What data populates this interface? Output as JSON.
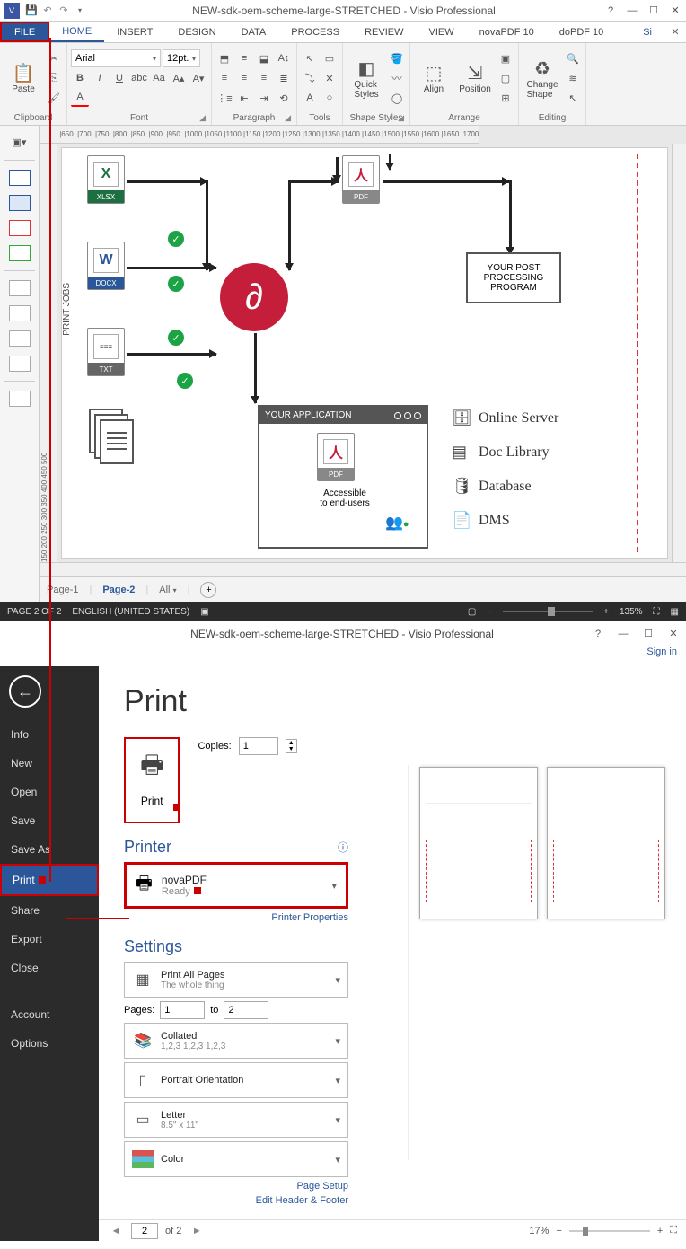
{
  "titlebar": {
    "app_icon_text": "V",
    "title": "NEW-sdk-oem-scheme-large-STRETCHED - Visio Professional",
    "help": "?",
    "signin_partial": "Si"
  },
  "tabs": {
    "file": "FILE",
    "home": "HOME",
    "insert": "INSERT",
    "design": "DESIGN",
    "data": "DATA",
    "process": "PROCESS",
    "review": "REVIEW",
    "view": "VIEW",
    "nova": "novaPDF 10",
    "dopdf": "doPDF 10"
  },
  "ribbon": {
    "clipboard": {
      "paste": "Paste",
      "label": "Clipboard"
    },
    "font": {
      "name": "Arial",
      "size": "12pt.",
      "label": "Font"
    },
    "paragraph": {
      "label": "Paragraph"
    },
    "tools": {
      "label": "Tools"
    },
    "shape_styles": {
      "quick": "Quick\nStyles",
      "label": "Shape Styles"
    },
    "arrange": {
      "align": "Align",
      "position": "Position",
      "label": "Arrange"
    },
    "editing": {
      "change": "Change\nShape",
      "label": "Editing"
    }
  },
  "pages": {
    "p1": "Page-1",
    "p2": "Page-2",
    "all": "All"
  },
  "status": {
    "page": "PAGE 2 OF 2",
    "lang": "ENGLISH (UNITED STATES)",
    "zoom": "135%"
  },
  "drawing": {
    "vlabel": "PRINT JOBS",
    "xlsx": "XLSX",
    "docx": "DOCX",
    "txt": "TXT",
    "pdf": "PDF",
    "your_app": "YOUR APPLICATION",
    "accessible": "Accessible\nto end-users",
    "proc": "YOUR POST PROCESSING PROGRAM",
    "svc_online": "Online Server",
    "svc_doclib": "Doc Library",
    "svc_db": "Database",
    "svc_dms": "DMS"
  },
  "backstage": {
    "title": "NEW-sdk-oem-scheme-large-STRETCHED - Visio Professional",
    "signin": "Sign in",
    "nav": {
      "info": "Info",
      "new": "New",
      "open": "Open",
      "save": "Save",
      "saveas": "Save As",
      "print": "Print",
      "share": "Share",
      "export": "Export",
      "close": "Close",
      "account": "Account",
      "options": "Options"
    },
    "print": {
      "heading": "Print",
      "print_btn": "Print",
      "copies_label": "Copies:",
      "copies_value": "1",
      "printer_h": "Printer",
      "printer_name": "novaPDF",
      "printer_status": "Ready",
      "printer_props": "Printer Properties",
      "settings_h": "Settings",
      "s_allpages": "Print All Pages",
      "s_allpages_sub": "The whole thing",
      "pages_label": "Pages:",
      "pages_from": "1",
      "pages_to_label": "to",
      "pages_to": "2",
      "s_collated": "Collated",
      "s_collated_sub": "1,2,3   1,2,3   1,2,3",
      "s_orient": "Portrait Orientation",
      "s_letter": "Letter",
      "s_letter_sub": "8.5\" x 11\"",
      "s_color": "Color",
      "page_setup": "Page Setup",
      "edit_hf": "Edit Header & Footer",
      "preview_current": "2",
      "preview_total": "of 2",
      "preview_zoom": "17%"
    }
  },
  "ruler_marks": [
    "650",
    "700",
    "750",
    "800",
    "850",
    "900",
    "950",
    "1000",
    "1050",
    "1100",
    "1150",
    "1200",
    "1250",
    "1300",
    "1350",
    "1400",
    "1450",
    "1500",
    "1550",
    "1600",
    "1650",
    "1700"
  ]
}
